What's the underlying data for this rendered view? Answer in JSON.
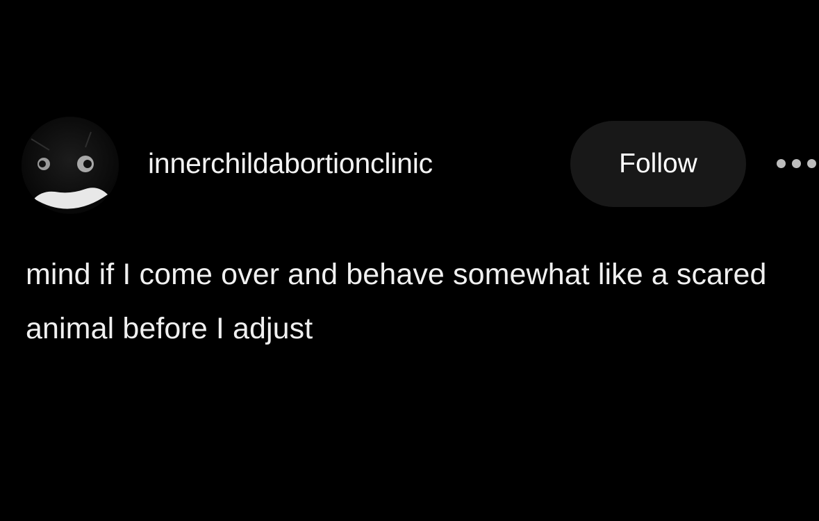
{
  "post": {
    "author": {
      "username": "innerchildabortionclinic",
      "avatar_icon": "cat-face-avatar"
    },
    "follow_label": "Follow",
    "more_icon": "ellipsis-icon",
    "text": "mind if I come over and behave somewhat like a scared animal before I adjust"
  },
  "colors": {
    "background": "#000000",
    "text": "#f0f0f0",
    "button_bg": "#181818"
  }
}
